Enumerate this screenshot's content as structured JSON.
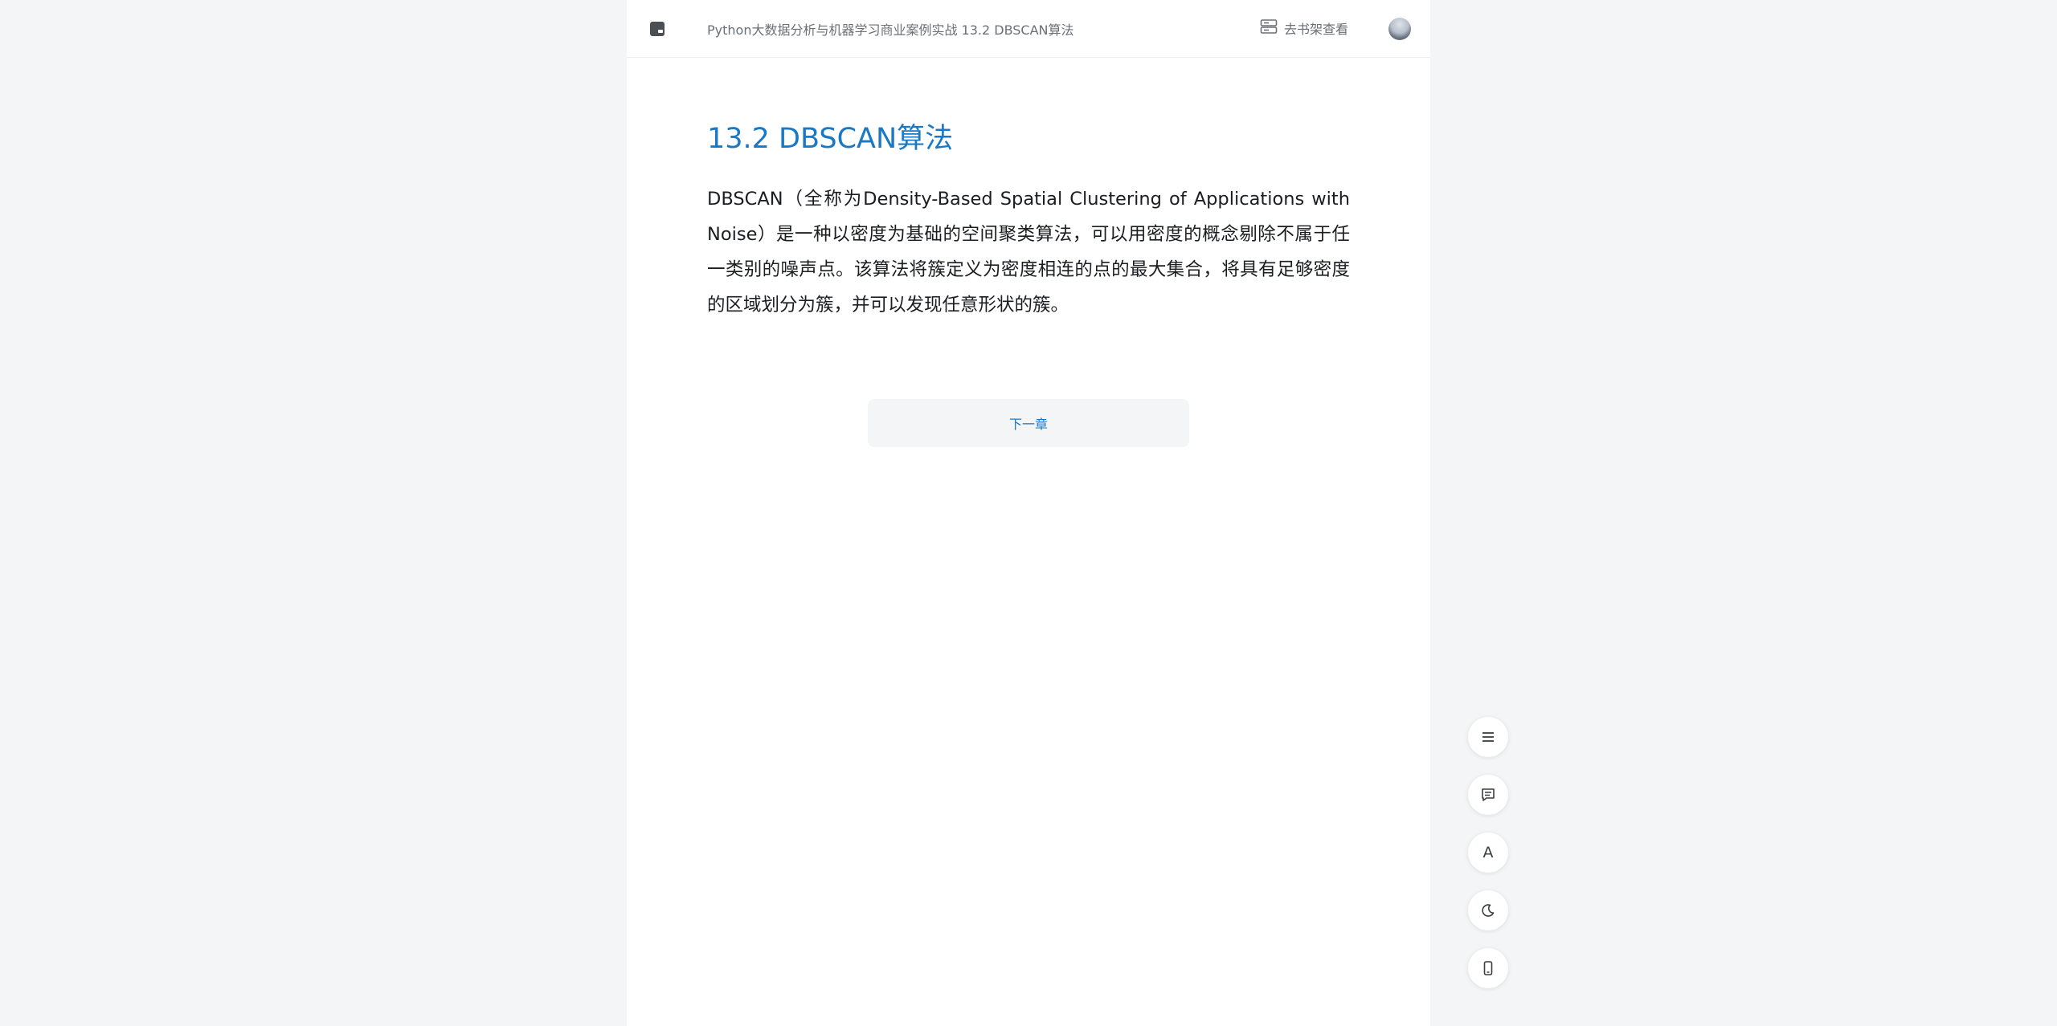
{
  "header": {
    "home_icon": "book-icon",
    "breadcrumb": "Python大数据分析与机器学习商业案例实战 13.2 DBSCAN算法",
    "shelf_link": "去书架查看",
    "shelf_icon": "bookshelf-icon"
  },
  "article": {
    "title": "13.2 DBSCAN算法",
    "paragraph": "DBSCAN（全称为Density-Based Spatial Clustering of Applications with Noise）是一种以密度为基础的空间聚类算法，可以用密度的概念剔除不属于任一类别的噪声点。该算法将簇定义为密度相连的点的最大集合，将具有足够密度的区域划分为簇，并可以发现任意形状的簇。"
  },
  "footer_nav": {
    "next_chapter": "下一章"
  },
  "tools": {
    "font_letter": "A",
    "icons": [
      "menu-icon",
      "comment-icon",
      "font-icon",
      "dark-mode-icon",
      "mobile-icon"
    ]
  },
  "colors": {
    "accent": "#1b78c2",
    "background": "#f4f5f7",
    "page": "#ffffff"
  }
}
